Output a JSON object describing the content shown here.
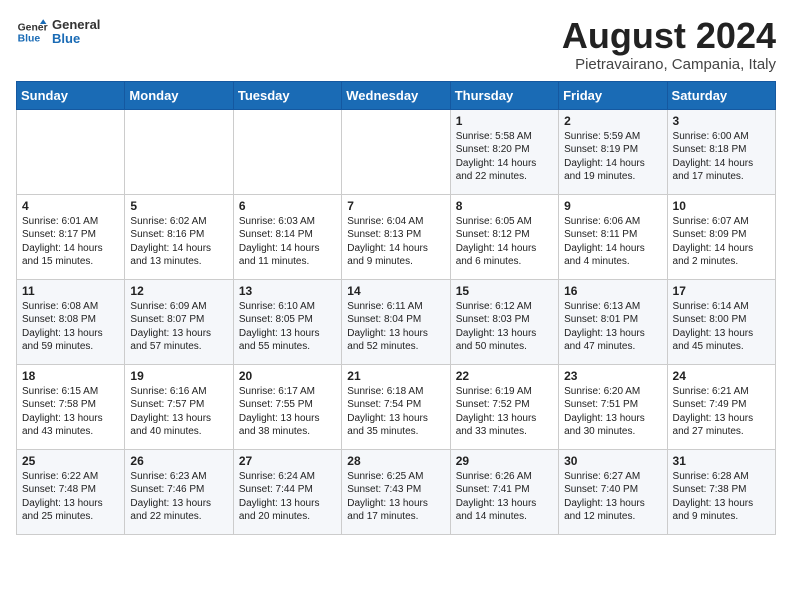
{
  "header": {
    "logo_general": "General",
    "logo_blue": "Blue",
    "month_title": "August 2024",
    "location": "Pietravairano, Campania, Italy"
  },
  "weekdays": [
    "Sunday",
    "Monday",
    "Tuesday",
    "Wednesday",
    "Thursday",
    "Friday",
    "Saturday"
  ],
  "weeks": [
    [
      {
        "day": "",
        "content": ""
      },
      {
        "day": "",
        "content": ""
      },
      {
        "day": "",
        "content": ""
      },
      {
        "day": "",
        "content": ""
      },
      {
        "day": "1",
        "content": "Sunrise: 5:58 AM\nSunset: 8:20 PM\nDaylight: 14 hours\nand 22 minutes."
      },
      {
        "day": "2",
        "content": "Sunrise: 5:59 AM\nSunset: 8:19 PM\nDaylight: 14 hours\nand 19 minutes."
      },
      {
        "day": "3",
        "content": "Sunrise: 6:00 AM\nSunset: 8:18 PM\nDaylight: 14 hours\nand 17 minutes."
      }
    ],
    [
      {
        "day": "4",
        "content": "Sunrise: 6:01 AM\nSunset: 8:17 PM\nDaylight: 14 hours\nand 15 minutes."
      },
      {
        "day": "5",
        "content": "Sunrise: 6:02 AM\nSunset: 8:16 PM\nDaylight: 14 hours\nand 13 minutes."
      },
      {
        "day": "6",
        "content": "Sunrise: 6:03 AM\nSunset: 8:14 PM\nDaylight: 14 hours\nand 11 minutes."
      },
      {
        "day": "7",
        "content": "Sunrise: 6:04 AM\nSunset: 8:13 PM\nDaylight: 14 hours\nand 9 minutes."
      },
      {
        "day": "8",
        "content": "Sunrise: 6:05 AM\nSunset: 8:12 PM\nDaylight: 14 hours\nand 6 minutes."
      },
      {
        "day": "9",
        "content": "Sunrise: 6:06 AM\nSunset: 8:11 PM\nDaylight: 14 hours\nand 4 minutes."
      },
      {
        "day": "10",
        "content": "Sunrise: 6:07 AM\nSunset: 8:09 PM\nDaylight: 14 hours\nand 2 minutes."
      }
    ],
    [
      {
        "day": "11",
        "content": "Sunrise: 6:08 AM\nSunset: 8:08 PM\nDaylight: 13 hours\nand 59 minutes."
      },
      {
        "day": "12",
        "content": "Sunrise: 6:09 AM\nSunset: 8:07 PM\nDaylight: 13 hours\nand 57 minutes."
      },
      {
        "day": "13",
        "content": "Sunrise: 6:10 AM\nSunset: 8:05 PM\nDaylight: 13 hours\nand 55 minutes."
      },
      {
        "day": "14",
        "content": "Sunrise: 6:11 AM\nSunset: 8:04 PM\nDaylight: 13 hours\nand 52 minutes."
      },
      {
        "day": "15",
        "content": "Sunrise: 6:12 AM\nSunset: 8:03 PM\nDaylight: 13 hours\nand 50 minutes."
      },
      {
        "day": "16",
        "content": "Sunrise: 6:13 AM\nSunset: 8:01 PM\nDaylight: 13 hours\nand 47 minutes."
      },
      {
        "day": "17",
        "content": "Sunrise: 6:14 AM\nSunset: 8:00 PM\nDaylight: 13 hours\nand 45 minutes."
      }
    ],
    [
      {
        "day": "18",
        "content": "Sunrise: 6:15 AM\nSunset: 7:58 PM\nDaylight: 13 hours\nand 43 minutes."
      },
      {
        "day": "19",
        "content": "Sunrise: 6:16 AM\nSunset: 7:57 PM\nDaylight: 13 hours\nand 40 minutes."
      },
      {
        "day": "20",
        "content": "Sunrise: 6:17 AM\nSunset: 7:55 PM\nDaylight: 13 hours\nand 38 minutes."
      },
      {
        "day": "21",
        "content": "Sunrise: 6:18 AM\nSunset: 7:54 PM\nDaylight: 13 hours\nand 35 minutes."
      },
      {
        "day": "22",
        "content": "Sunrise: 6:19 AM\nSunset: 7:52 PM\nDaylight: 13 hours\nand 33 minutes."
      },
      {
        "day": "23",
        "content": "Sunrise: 6:20 AM\nSunset: 7:51 PM\nDaylight: 13 hours\nand 30 minutes."
      },
      {
        "day": "24",
        "content": "Sunrise: 6:21 AM\nSunset: 7:49 PM\nDaylight: 13 hours\nand 27 minutes."
      }
    ],
    [
      {
        "day": "25",
        "content": "Sunrise: 6:22 AM\nSunset: 7:48 PM\nDaylight: 13 hours\nand 25 minutes."
      },
      {
        "day": "26",
        "content": "Sunrise: 6:23 AM\nSunset: 7:46 PM\nDaylight: 13 hours\nand 22 minutes."
      },
      {
        "day": "27",
        "content": "Sunrise: 6:24 AM\nSunset: 7:44 PM\nDaylight: 13 hours\nand 20 minutes."
      },
      {
        "day": "28",
        "content": "Sunrise: 6:25 AM\nSunset: 7:43 PM\nDaylight: 13 hours\nand 17 minutes."
      },
      {
        "day": "29",
        "content": "Sunrise: 6:26 AM\nSunset: 7:41 PM\nDaylight: 13 hours\nand 14 minutes."
      },
      {
        "day": "30",
        "content": "Sunrise: 6:27 AM\nSunset: 7:40 PM\nDaylight: 13 hours\nand 12 minutes."
      },
      {
        "day": "31",
        "content": "Sunrise: 6:28 AM\nSunset: 7:38 PM\nDaylight: 13 hours\nand 9 minutes."
      }
    ]
  ]
}
